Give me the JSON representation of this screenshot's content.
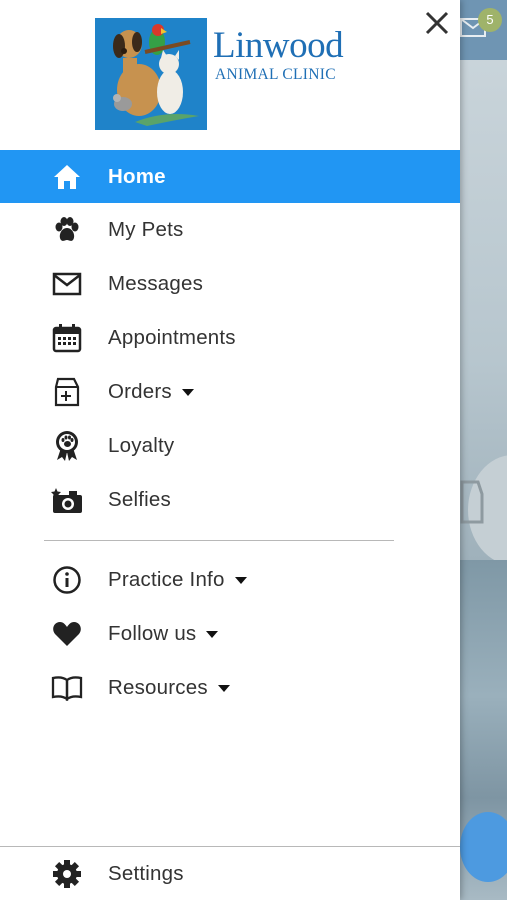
{
  "background": {
    "badge_count": "5",
    "colors": {
      "header": "#6f95b3",
      "fab": "#4d9ae0",
      "badge": "#9fb36a"
    }
  },
  "drawer": {
    "close_icon": "close-icon",
    "logo": {
      "name": "Linwood",
      "subtitle": "ANIMAL CLINIC",
      "color": "#1f6fb5"
    },
    "accent_color": "#2196f3",
    "primary_items": [
      {
        "label": "Home",
        "icon": "home-icon",
        "active": true
      },
      {
        "label": "My Pets",
        "icon": "paw-icon"
      },
      {
        "label": "Messages",
        "icon": "envelope-icon"
      },
      {
        "label": "Appointments",
        "icon": "calendar-icon"
      },
      {
        "label": "Orders",
        "icon": "pet-food-bag-icon",
        "has_dropdown": true
      },
      {
        "label": "Loyalty",
        "icon": "award-ribbon-icon"
      },
      {
        "label": "Selfies",
        "icon": "camera-icon"
      }
    ],
    "secondary_items": [
      {
        "label": "Practice Info",
        "icon": "info-icon",
        "has_dropdown": true
      },
      {
        "label": "Follow us",
        "icon": "heart-icon",
        "has_dropdown": true
      },
      {
        "label": "Resources",
        "icon": "book-icon",
        "has_dropdown": true
      }
    ],
    "footer": {
      "label": "Settings",
      "icon": "gear-icon"
    }
  }
}
